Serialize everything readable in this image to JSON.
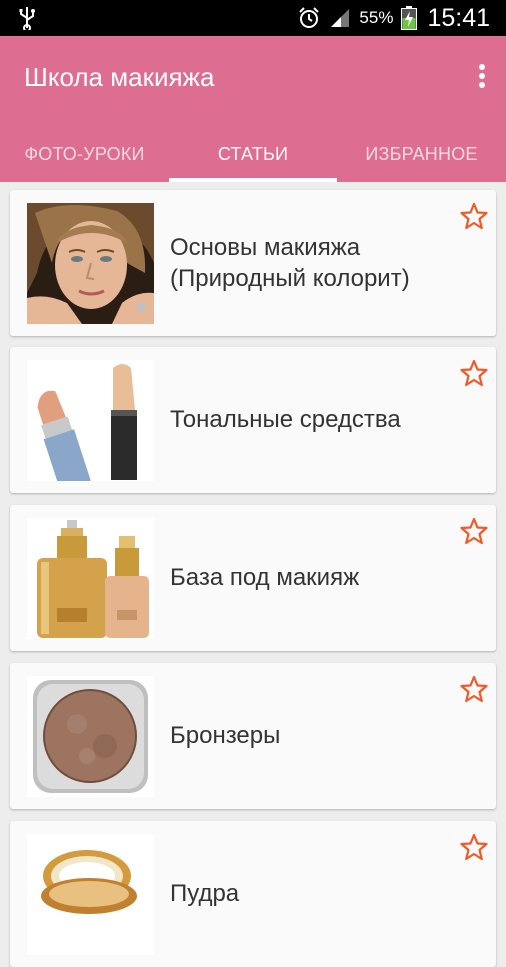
{
  "status_bar": {
    "battery_percent": "55%",
    "time": "15:41"
  },
  "app_bar": {
    "title": "Школа макияжа"
  },
  "tabs": [
    {
      "label": "ФОТО-УРОКИ",
      "active": false
    },
    {
      "label": "СТАТЬИ",
      "active": true
    },
    {
      "label": "ИЗБРАННОЕ",
      "active": false
    }
  ],
  "articles": [
    {
      "title": "Основы макияжа (Природный колорит)",
      "thumbnail": "woman-portrait",
      "favorite": false
    },
    {
      "title": "Тональные средства",
      "thumbnail": "lipstick-and-concealer",
      "favorite": false
    },
    {
      "title": "База под макияж",
      "thumbnail": "foundation-bottles",
      "favorite": false
    },
    {
      "title": "Бронзеры",
      "thumbnail": "bronzer-powder-jar",
      "favorite": false
    },
    {
      "title": "Пудра",
      "thumbnail": "compact-powder",
      "favorite": false
    }
  ],
  "colors": {
    "app_bar": "#dd6d91",
    "star_outline": "#f05a28",
    "background": "#ededed",
    "card": "#fafafa"
  }
}
